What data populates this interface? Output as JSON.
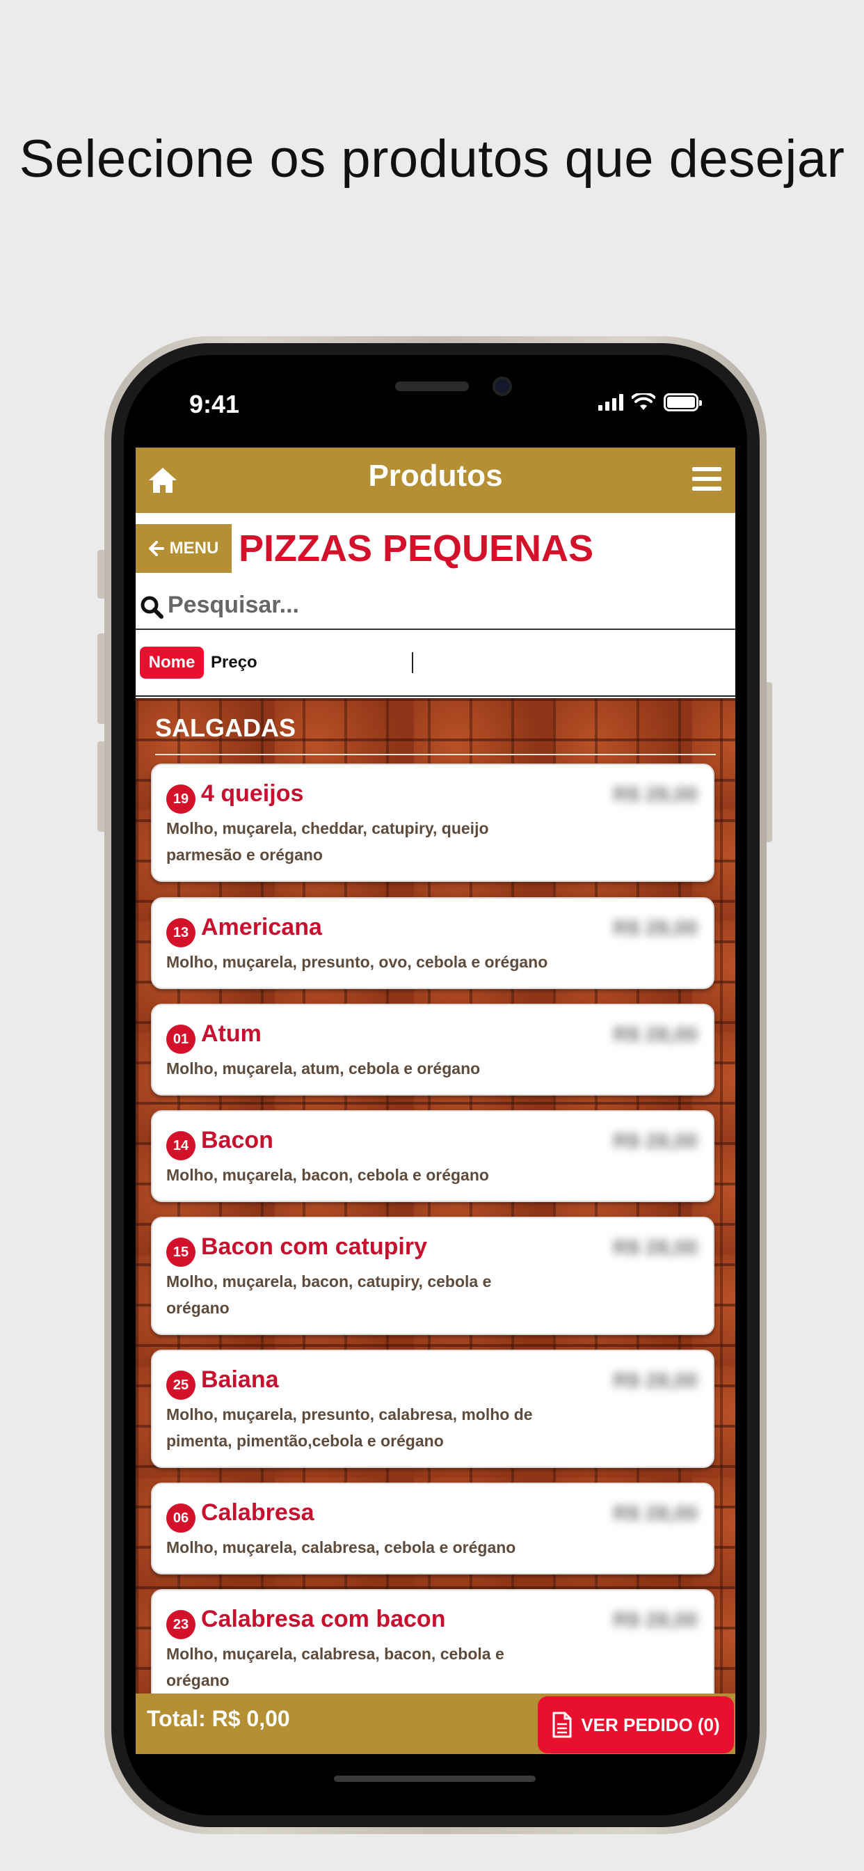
{
  "headline": "Selecione os produtos que desejar",
  "status_bar": {
    "time": "9:41"
  },
  "topbar": {
    "title": "Produtos",
    "home_icon": "home-icon",
    "menu_icon": "hamburger-icon"
  },
  "category": {
    "back_label": "MENU",
    "title": "PIZZAS PEQUENAS"
  },
  "search": {
    "placeholder": "Pesquisar...",
    "icon": "search-icon"
  },
  "sort": {
    "options": [
      "Nome",
      "Preço"
    ],
    "selected": "Nome"
  },
  "section": {
    "title": "SALGADAS"
  },
  "products": [
    {
      "code": "19",
      "name": "4 queijos",
      "description": "Molho, muçarela, cheddar, catupiry, queijo parmesão e orégano",
      "price": "R$ 28,00"
    },
    {
      "code": "13",
      "name": "Americana",
      "description": "Molho, muçarela, presunto, ovo, cebola e orégano",
      "price": "R$ 28,00"
    },
    {
      "code": "01",
      "name": "Atum",
      "description": "Molho, muçarela, atum, cebola e orégano",
      "price": "R$ 28,00"
    },
    {
      "code": "14",
      "name": "Bacon",
      "description": "Molho, muçarela, bacon, cebola e orégano",
      "price": "R$ 28,00"
    },
    {
      "code": "15",
      "name": "Bacon com catupiry",
      "description": "Molho, muçarela, bacon, catupiry, cebola e orégano",
      "price": "R$ 28,00"
    },
    {
      "code": "25",
      "name": "Baiana",
      "description": "Molho, muçarela, presunto, calabresa, molho de pimenta, pimentão,cebola e orégano",
      "price": "R$ 28,00"
    },
    {
      "code": "06",
      "name": "Calabresa",
      "description": "Molho, muçarela, calabresa, cebola e orégano",
      "price": "R$ 28,00"
    },
    {
      "code": "23",
      "name": "Calabresa com bacon",
      "description": "Molho, muçarela, calabresa, bacon, cebola e orégano",
      "price": "R$ 28,00"
    }
  ],
  "footer": {
    "total": "Total: R$ 0,00",
    "order_button": "VER PEDIDO (0)",
    "order_icon": "document-icon"
  },
  "colors": {
    "gold": "#b58f34",
    "red": "#d4112b",
    "button_red": "#e8102f"
  }
}
